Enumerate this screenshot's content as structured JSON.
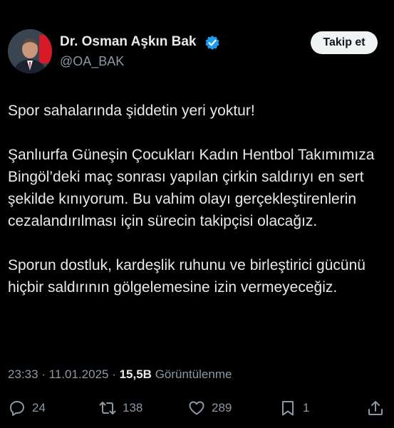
{
  "tweet": {
    "author": {
      "display_name": "Dr. Osman Aşkın Bak",
      "handle": "@OA_BAK",
      "verified_icon": "verified-badge-icon",
      "verified_color": "#1d9bf0"
    },
    "follow_label": "Takip et",
    "paragraphs": [
      "Spor sahalarında şiddetin yeri yoktur!",
      "Şanlıurfa Güneşin Çocukları Kadın Hentbol Takımımıza Bingöl’deki maç sonrası yapılan çirkin saldırıyı en sert şekilde kınıyorum. Bu vahim olayı gerçekleştirenlerin cezalandırılması için sürecin takipçisi olacağız.",
      "Sporun dostluk, kardeşlik ruhunu ve birleştirici gücünü hiçbir saldırının gölgelemesine izin vermeyeceğiz."
    ],
    "time": "23:33",
    "date": "11.01.2025",
    "separator": " · ",
    "views_count": "15,5B",
    "views_label": "Görüntülenme",
    "actions": {
      "replies": "24",
      "reposts": "138",
      "likes": "289",
      "bookmarks": "1",
      "share": ""
    }
  },
  "colors": {
    "background": "#000000",
    "text": "#e7e9ea",
    "secondary": "#8b98a5",
    "button_bg": "#eff3f4"
  }
}
